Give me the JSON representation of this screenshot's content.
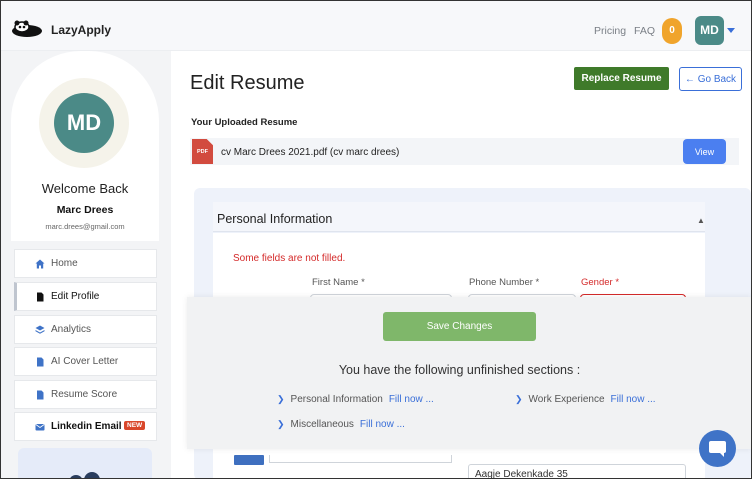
{
  "header": {
    "brand": "LazyApply",
    "nav": [
      "Pricing",
      "FAQ"
    ],
    "count_badge": "0",
    "avatar_initials": "MD"
  },
  "sidebar": {
    "avatar_initials": "MD",
    "welcome": "Welcome Back",
    "name": "Marc Drees",
    "email": "marc.drees@gmail.com",
    "items": [
      {
        "label": "Home",
        "icon": "home-icon"
      },
      {
        "label": "Edit Profile",
        "icon": "document-icon"
      },
      {
        "label": "Analytics",
        "icon": "layers-icon"
      },
      {
        "label": "AI Cover Letter",
        "icon": "document-icon"
      },
      {
        "label": "Resume Score",
        "icon": "document-icon"
      },
      {
        "label": "Linkedin Email",
        "icon": "envelope-icon",
        "badge": "NEW"
      }
    ]
  },
  "main": {
    "title": "Edit Resume",
    "replace_label": "Replace Resume",
    "back_label": "← Go Back",
    "uploaded_heading": "Your Uploaded Resume",
    "file_icon_text": "PDF",
    "file_name": "cv Marc Drees 2021.pdf (cv marc drees)",
    "view_label": "View",
    "section_title": "Personal Information",
    "warning": "Some fields are not filled.",
    "labels": {
      "first_name": "First Name *",
      "phone": "Phone Number *",
      "gender": "Gender *"
    },
    "address_value": "Aagje Dekenkade 35"
  },
  "overlay": {
    "save_label": "Save Changes",
    "heading": "You have the following unfinished sections :",
    "fill_label": "Fill now ...",
    "sections": [
      "Personal Information",
      "Work Experience",
      "Miscellaneous"
    ]
  },
  "colors": {
    "accent_blue": "#3a6fd8",
    "replace_green": "#3f7a2a",
    "save_green": "#7fb76a",
    "error_red": "#d42a2a",
    "avatar_teal": "#4b8a87",
    "badge_orange": "#f0a42b"
  }
}
